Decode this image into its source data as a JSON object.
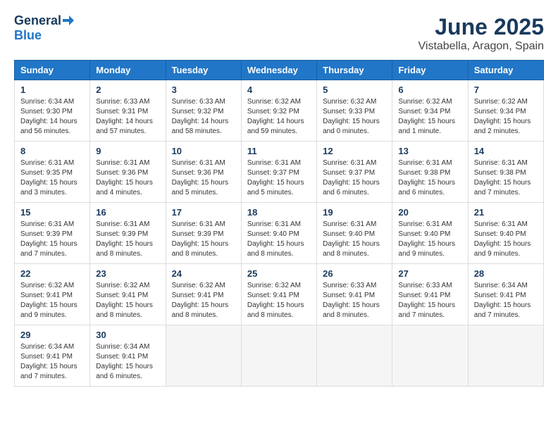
{
  "header": {
    "logo_line1": "General",
    "logo_line2": "Blue",
    "title": "June 2025",
    "subtitle": "Vistabella, Aragon, Spain"
  },
  "calendar": {
    "days_of_week": [
      "Sunday",
      "Monday",
      "Tuesday",
      "Wednesday",
      "Thursday",
      "Friday",
      "Saturday"
    ],
    "weeks": [
      [
        {
          "day": "",
          "info": ""
        },
        {
          "day": "2",
          "info": "Sunrise: 6:33 AM\nSunset: 9:31 PM\nDaylight: 14 hours\nand 57 minutes."
        },
        {
          "day": "3",
          "info": "Sunrise: 6:33 AM\nSunset: 9:32 PM\nDaylight: 14 hours\nand 58 minutes."
        },
        {
          "day": "4",
          "info": "Sunrise: 6:32 AM\nSunset: 9:32 PM\nDaylight: 14 hours\nand 59 minutes."
        },
        {
          "day": "5",
          "info": "Sunrise: 6:32 AM\nSunset: 9:33 PM\nDaylight: 15 hours\nand 0 minutes."
        },
        {
          "day": "6",
          "info": "Sunrise: 6:32 AM\nSunset: 9:34 PM\nDaylight: 15 hours\nand 1 minute."
        },
        {
          "day": "7",
          "info": "Sunrise: 6:32 AM\nSunset: 9:34 PM\nDaylight: 15 hours\nand 2 minutes."
        }
      ],
      [
        {
          "day": "1",
          "info": "Sunrise: 6:34 AM\nSunset: 9:30 PM\nDaylight: 14 hours\nand 56 minutes."
        },
        {
          "day": "8",
          "info": "Sunrise: 6:31 AM\nSunset: 9:35 PM\nDaylight: 15 hours\nand 3 minutes."
        },
        {
          "day": "9",
          "info": "Sunrise: 6:31 AM\nSunset: 9:36 PM\nDaylight: 15 hours\nand 4 minutes."
        },
        {
          "day": "10",
          "info": "Sunrise: 6:31 AM\nSunset: 9:36 PM\nDaylight: 15 hours\nand 5 minutes."
        },
        {
          "day": "11",
          "info": "Sunrise: 6:31 AM\nSunset: 9:37 PM\nDaylight: 15 hours\nand 5 minutes."
        },
        {
          "day": "12",
          "info": "Sunrise: 6:31 AM\nSunset: 9:37 PM\nDaylight: 15 hours\nand 6 minutes."
        },
        {
          "day": "13",
          "info": "Sunrise: 6:31 AM\nSunset: 9:38 PM\nDaylight: 15 hours\nand 6 minutes."
        },
        {
          "day": "14",
          "info": "Sunrise: 6:31 AM\nSunset: 9:38 PM\nDaylight: 15 hours\nand 7 minutes."
        }
      ],
      [
        {
          "day": "15",
          "info": "Sunrise: 6:31 AM\nSunset: 9:39 PM\nDaylight: 15 hours\nand 7 minutes."
        },
        {
          "day": "16",
          "info": "Sunrise: 6:31 AM\nSunset: 9:39 PM\nDaylight: 15 hours\nand 8 minutes."
        },
        {
          "day": "17",
          "info": "Sunrise: 6:31 AM\nSunset: 9:39 PM\nDaylight: 15 hours\nand 8 minutes."
        },
        {
          "day": "18",
          "info": "Sunrise: 6:31 AM\nSunset: 9:40 PM\nDaylight: 15 hours\nand 8 minutes."
        },
        {
          "day": "19",
          "info": "Sunrise: 6:31 AM\nSunset: 9:40 PM\nDaylight: 15 hours\nand 8 minutes."
        },
        {
          "day": "20",
          "info": "Sunrise: 6:31 AM\nSunset: 9:40 PM\nDaylight: 15 hours\nand 9 minutes."
        },
        {
          "day": "21",
          "info": "Sunrise: 6:31 AM\nSunset: 9:40 PM\nDaylight: 15 hours\nand 9 minutes."
        }
      ],
      [
        {
          "day": "22",
          "info": "Sunrise: 6:32 AM\nSunset: 9:41 PM\nDaylight: 15 hours\nand 9 minutes."
        },
        {
          "day": "23",
          "info": "Sunrise: 6:32 AM\nSunset: 9:41 PM\nDaylight: 15 hours\nand 8 minutes."
        },
        {
          "day": "24",
          "info": "Sunrise: 6:32 AM\nSunset: 9:41 PM\nDaylight: 15 hours\nand 8 minutes."
        },
        {
          "day": "25",
          "info": "Sunrise: 6:32 AM\nSunset: 9:41 PM\nDaylight: 15 hours\nand 8 minutes."
        },
        {
          "day": "26",
          "info": "Sunrise: 6:33 AM\nSunset: 9:41 PM\nDaylight: 15 hours\nand 8 minutes."
        },
        {
          "day": "27",
          "info": "Sunrise: 6:33 AM\nSunset: 9:41 PM\nDaylight: 15 hours\nand 7 minutes."
        },
        {
          "day": "28",
          "info": "Sunrise: 6:34 AM\nSunset: 9:41 PM\nDaylight: 15 hours\nand 7 minutes."
        }
      ],
      [
        {
          "day": "29",
          "info": "Sunrise: 6:34 AM\nSunset: 9:41 PM\nDaylight: 15 hours\nand 7 minutes."
        },
        {
          "day": "30",
          "info": "Sunrise: 6:34 AM\nSunset: 9:41 PM\nDaylight: 15 hours\nand 6 minutes."
        },
        {
          "day": "",
          "info": ""
        },
        {
          "day": "",
          "info": ""
        },
        {
          "day": "",
          "info": ""
        },
        {
          "day": "",
          "info": ""
        },
        {
          "day": "",
          "info": ""
        }
      ]
    ]
  }
}
